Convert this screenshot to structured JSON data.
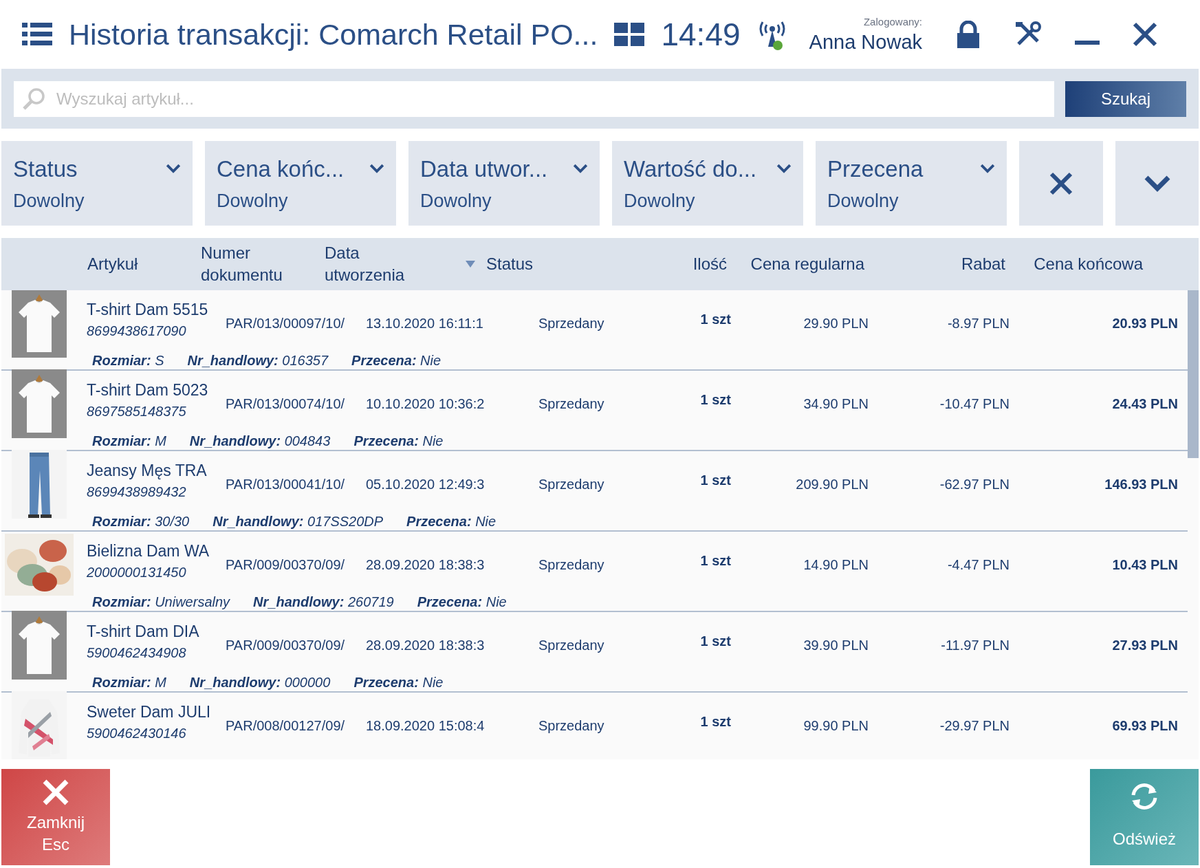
{
  "header": {
    "title": "Historia transakcji: Comarch Retail PO...",
    "time": "14:49",
    "logged_in_label": "Zalogowany:",
    "user": "Anna Nowak"
  },
  "search": {
    "placeholder": "Wyszukaj artykuł...",
    "button": "Szukaj"
  },
  "filters": [
    {
      "label": "Status",
      "value": "Dowolny"
    },
    {
      "label": "Cena końc...",
      "value": "Dowolny"
    },
    {
      "label": "Data utwor...",
      "value": "Dowolny"
    },
    {
      "label": "Wartość do...",
      "value": "Dowolny"
    },
    {
      "label": "Przecena",
      "value": "Dowolny"
    }
  ],
  "table": {
    "columns": [
      {
        "label": "Artykuł",
        "sorted": false
      },
      {
        "label": "Numer dokumentu",
        "sorted": false
      },
      {
        "label": "Data utworzenia",
        "sorted": true
      },
      {
        "label": "Status",
        "sorted": false
      },
      {
        "label": "Ilość",
        "sorted": false
      },
      {
        "label": "Cena regularna",
        "sorted": false
      },
      {
        "label": "Rabat",
        "sorted": false
      },
      {
        "label": "Cena końcowa",
        "sorted": false
      }
    ],
    "rows": [
      {
        "name": "T-shirt Dam 5515",
        "code": "8699438617090",
        "document": "PAR/013/00097/10/",
        "date": "13.10.2020 16:11:1",
        "status": "Sprzedany",
        "quantity": "1 szt",
        "regular_price": "29.90 PLN",
        "discount": "-8.97 PLN",
        "final_price": "20.93 PLN",
        "details": [
          {
            "label": "Rozmiar:",
            "value": "S"
          },
          {
            "label": "Nr_handlowy:",
            "value": "016357"
          },
          {
            "label": "Przecena:",
            "value": "Nie"
          }
        ]
      },
      {
        "name": "T-shirt Dam 5023",
        "code": "8697585148375",
        "document": "PAR/013/00074/10/",
        "date": "10.10.2020 10:36:2",
        "status": "Sprzedany",
        "quantity": "1 szt",
        "regular_price": "34.90 PLN",
        "discount": "-10.47 PLN",
        "final_price": "24.43 PLN",
        "details": [
          {
            "label": "Rozmiar:",
            "value": "M"
          },
          {
            "label": "Nr_handlowy:",
            "value": "004843"
          },
          {
            "label": "Przecena:",
            "value": "Nie"
          }
        ]
      },
      {
        "name": "Jeansy Męs TRA",
        "code": "8699438989432",
        "document": "PAR/013/00041/10/",
        "date": "05.10.2020 12:49:3",
        "status": "Sprzedany",
        "quantity": "1 szt",
        "regular_price": "209.90 PLN",
        "discount": "-62.97 PLN",
        "final_price": "146.93 PLN",
        "details": [
          {
            "label": "Rozmiar:",
            "value": "30/30"
          },
          {
            "label": "Nr_handlowy:",
            "value": "017SS20DP"
          },
          {
            "label": "Przecena:",
            "value": "Nie"
          }
        ]
      },
      {
        "name": "Bielizna Dam WA",
        "code": "2000000131450",
        "document": "PAR/009/00370/09/",
        "date": "28.09.2020 18:38:3",
        "status": "Sprzedany",
        "quantity": "1 szt",
        "regular_price": "14.90 PLN",
        "discount": "-4.47 PLN",
        "final_price": "10.43 PLN",
        "details": [
          {
            "label": "Rozmiar:",
            "value": "Uniwersalny"
          },
          {
            "label": "Nr_handlowy:",
            "value": "260719"
          },
          {
            "label": "Przecena:",
            "value": "Nie"
          }
        ]
      },
      {
        "name": "T-shirt Dam DIA",
        "code": "5900462434908",
        "document": "PAR/009/00370/09/",
        "date": "28.09.2020 18:38:3",
        "status": "Sprzedany",
        "quantity": "1 szt",
        "regular_price": "39.90 PLN",
        "discount": "-11.97 PLN",
        "final_price": "27.93 PLN",
        "details": [
          {
            "label": "Rozmiar:",
            "value": "M"
          },
          {
            "label": "Nr_handlowy:",
            "value": "000000"
          },
          {
            "label": "Przecena:",
            "value": "Nie"
          }
        ]
      },
      {
        "name": "Sweter Dam JULI",
        "code": "5900462430146",
        "document": "PAR/008/00127/09/",
        "date": "18.09.2020 15:08:4",
        "status": "Sprzedany",
        "quantity": "1 szt",
        "regular_price": "99.90 PLN",
        "discount": "-29.97 PLN",
        "final_price": "69.93 PLN"
      }
    ]
  },
  "footer": {
    "close_button": {
      "label": "Zamknij",
      "shortcut": "Esc"
    },
    "refresh_button": {
      "label": "Odśwież"
    }
  }
}
